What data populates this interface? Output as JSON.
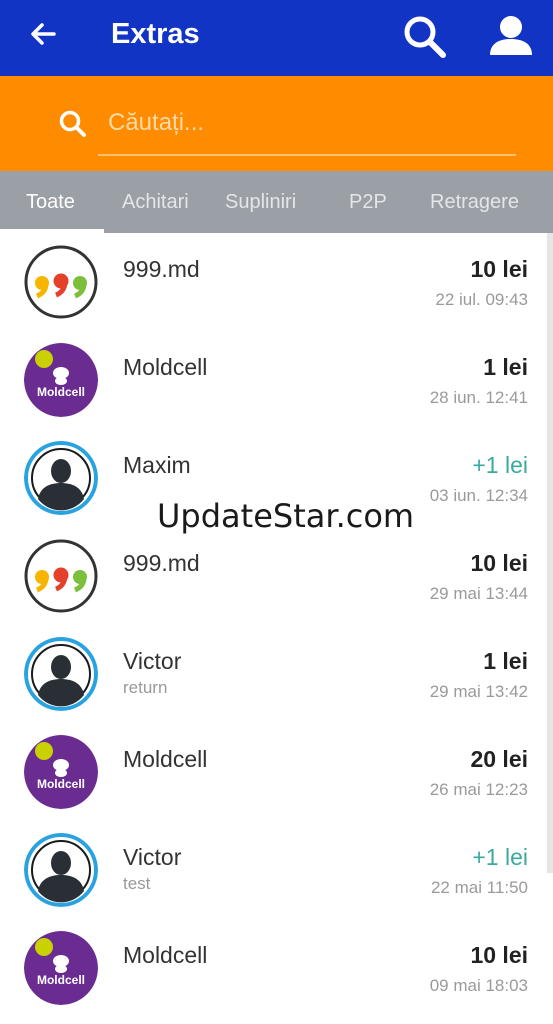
{
  "appbar": {
    "title": "Extras",
    "back_icon": "arrow-left-icon",
    "search_icon": "search-icon",
    "profile_icon": "user-icon",
    "color": "#1234c4"
  },
  "search": {
    "placeholder": "Căutați...",
    "value": "",
    "color": "#ff8c00"
  },
  "tabs": [
    {
      "label": "Toate",
      "active": true
    },
    {
      "label": "Achitari",
      "active": false
    },
    {
      "label": "Supliniri",
      "active": false
    },
    {
      "label": "P2P",
      "active": false
    },
    {
      "label": "Retragere",
      "active": false
    }
  ],
  "transactions": [
    {
      "name": "999.md",
      "sub": "",
      "amount": "10 lei",
      "date": "22 iul. 09:43",
      "avatar": "999md-logo",
      "credit": false
    },
    {
      "name": "Moldcell",
      "sub": "",
      "amount": "1 lei",
      "date": "28 iun. 12:41",
      "avatar": "moldcell-logo",
      "credit": false
    },
    {
      "name": "Maxim",
      "sub": "",
      "amount": "+1 lei",
      "date": "03 iun. 12:34",
      "avatar": "person-avatar",
      "credit": true
    },
    {
      "name": "999.md",
      "sub": "",
      "amount": "10 lei",
      "date": "29 mai 13:44",
      "avatar": "999md-logo",
      "credit": false
    },
    {
      "name": "Victor",
      "sub": "return",
      "amount": "1 lei",
      "date": "29 mai 13:42",
      "avatar": "person-avatar",
      "credit": false
    },
    {
      "name": "Moldcell",
      "sub": "",
      "amount": "20 lei",
      "date": "26 mai 12:23",
      "avatar": "moldcell-logo",
      "credit": false
    },
    {
      "name": "Victor",
      "sub": "test",
      "amount": "+1 lei",
      "date": "22 mai 11:50",
      "avatar": "person-avatar",
      "credit": true
    },
    {
      "name": "Moldcell",
      "sub": "",
      "amount": "10 lei",
      "date": "09 mai 18:03",
      "avatar": "moldcell-logo",
      "credit": false
    }
  ],
  "colors": {
    "credit": "#3aaa9c",
    "moldcell": "#6a2c91",
    "tabs_bg": "#9aa0a6"
  },
  "watermark": "UpdateStar.com",
  "moldcell_logo_text": "Moldcell"
}
